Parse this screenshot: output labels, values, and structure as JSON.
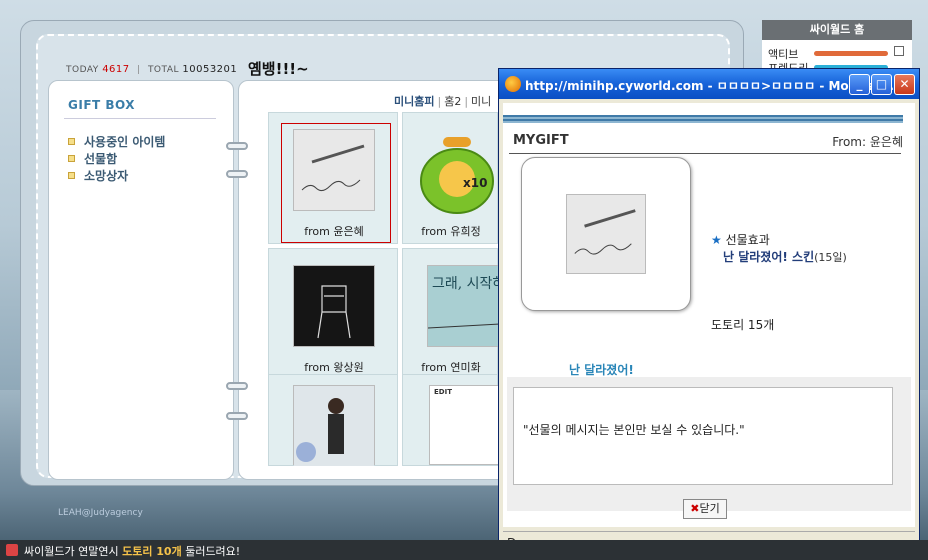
{
  "minihompy": {
    "today_label": "TODAY",
    "today_count": "4617",
    "total_label": "TOTAL",
    "total_count": "10053201",
    "title": "옘뱅!!!~",
    "credit": "LEAH@Judyagency"
  },
  "giftbox": {
    "title": "GIFT BOX",
    "menu": [
      "사용중인 아이템",
      "선물함",
      "소망상자"
    ]
  },
  "nav": {
    "items": [
      "미니홈피",
      "홈2",
      "미니"
    ]
  },
  "gifts": [
    {
      "from": "from 윤은혜",
      "selected": true,
      "icon": "pen-handwriting-image"
    },
    {
      "from": "from 유희정",
      "selected": false,
      "icon": "coin-purse-acorn-image",
      "badge": "x10"
    },
    {
      "from": "from 왕상원",
      "selected": false,
      "icon": "chair-sketch-image"
    },
    {
      "from": "from 연미화",
      "selected": false,
      "icon": "sky-text-image",
      "caption": "그래, 시작하는거야"
    },
    {
      "from": "",
      "selected": false,
      "icon": "woman-photo-image"
    },
    {
      "from": "",
      "selected": false,
      "icon": "edit-box-image",
      "caption": "EDIT"
    }
  ],
  "sidebar": {
    "title": "싸이월드 홈",
    "rows": [
      {
        "label": "액티브",
        "color": "#e06a3a"
      },
      {
        "label": "프렌드리",
        "color": "#2ab0d8"
      }
    ]
  },
  "popup": {
    "title": "http://minihp.cyworld.com - ㅁㅁㅁㅁ>ㅁㅁㅁㅁ - Mozilla ...",
    "heading": "MYGIFT",
    "from_label": "From:",
    "from_name": "윤은혜",
    "effect_label": "선물효과",
    "effect_name": "난 달라졌어! 스킨",
    "effect_duration": "(15일)",
    "acorn": "도토리 15개",
    "caption": "난 달라졌어!",
    "message": "\"선물의 메시지는 본인만 보실 수 있습니다.\"",
    "close_label": "닫기",
    "status": "Done"
  },
  "bottombar": {
    "text_a": "싸이월드가 연말연시 ",
    "text_b": "도토리 10개",
    "text_c": " 둘러드려요!"
  }
}
